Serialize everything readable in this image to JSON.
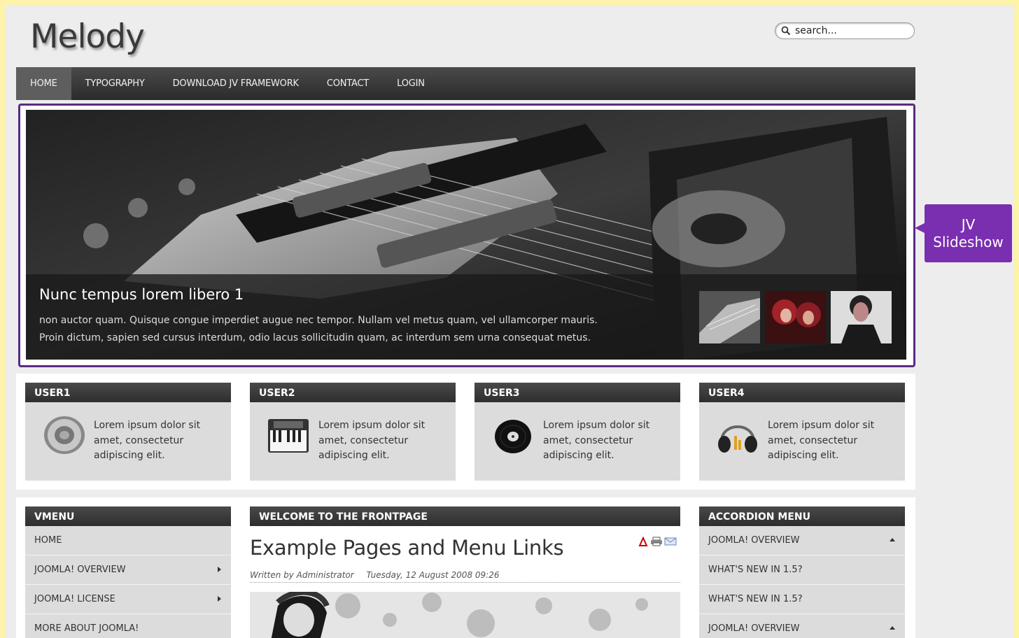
{
  "site": {
    "logo": "Melody"
  },
  "search": {
    "placeholder": "search..."
  },
  "nav": {
    "items": [
      {
        "label": "HOME"
      },
      {
        "label": "TYPOGRAPHY"
      },
      {
        "label": "DOWNLOAD JV FRAMEWORK"
      },
      {
        "label": "CONTACT"
      },
      {
        "label": "LOGIN"
      }
    ]
  },
  "slideshow": {
    "title": "Nunc tempus lorem libero 1",
    "line1": "non auctor quam. Quisque congue imperdiet augue nec tempor. Nullam vel metus quam, vel ullamcorper mauris.",
    "line2": "Proin dictum, sapien sed cursus interdum, odio lacus sollicitudin quam, ac interdum sem urna consequat metus."
  },
  "annotation": {
    "line1": "JV",
    "line2": "Slideshow"
  },
  "user_modules": [
    {
      "title": "USER1",
      "line1": "Lorem ipsum dolor sit",
      "line2": "amet, consectetur",
      "line3": "adipiscing elit.",
      "icon": "speaker-icon"
    },
    {
      "title": "USER2",
      "line1": "Lorem ipsum dolor sit",
      "line2": "amet, consectetur",
      "line3": "adipiscing elit.",
      "icon": "keyboard-icon"
    },
    {
      "title": "USER3",
      "line1": "Lorem ipsum dolor sit",
      "line2": "amet, consectetur",
      "line3": "adipiscing elit.",
      "icon": "vinyl-record-icon"
    },
    {
      "title": "USER4",
      "line1": "Lorem ipsum dolor sit",
      "line2": "amet, consectetur",
      "line3": "adipiscing elit.",
      "icon": "headphones-icon"
    }
  ],
  "vmenu": {
    "title": "VMENU",
    "items": [
      {
        "label": "HOME"
      },
      {
        "label": "JOOMLA! OVERVIEW"
      },
      {
        "label": "JOOMLA! LICENSE"
      },
      {
        "label": "MORE ABOUT JOOMLA!"
      }
    ]
  },
  "main": {
    "title": "WELCOME TO THE FRONTPAGE",
    "article_title": "Example Pages and Menu Links",
    "author": "Written by Administrator",
    "date": "Tuesday, 12 August 2008 09:26"
  },
  "accordion": {
    "title": "ACCORDION MENU",
    "items": [
      {
        "label": "JOOMLA! OVERVIEW"
      },
      {
        "label": "WHAT'S NEW IN 1.5?"
      },
      {
        "label": "WHAT'S NEW IN 1.5?"
      },
      {
        "label": "JOOMLA! OVERVIEW"
      }
    ]
  },
  "colors": {
    "accent": "#7a2eb0",
    "frame": "#5b2a86",
    "header_bar": "#3a3a3a",
    "page_bg": "#fdf3a9"
  }
}
